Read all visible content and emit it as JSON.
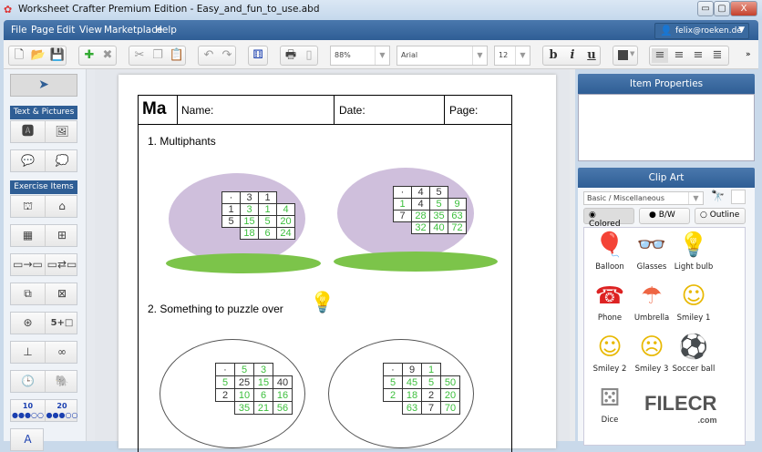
{
  "window": {
    "title": "Worksheet Crafter Premium Edition - Easy_and_fun_to_use.abd",
    "minimize": "▭",
    "maximize": "▢",
    "close": "X"
  },
  "menu": [
    "File",
    "Page",
    "Edit",
    "View",
    "Marketplace",
    "Help"
  ],
  "user": {
    "email": "felix@roeken.de"
  },
  "toolbar": {
    "zoom": "88%",
    "font": "Arial",
    "size": "12",
    "bold": "b",
    "italic": "i",
    "underline": "u",
    "more": "»"
  },
  "sidebar": {
    "text_pictures": "Text & Pictures",
    "exercise_items": "Exercise Items",
    "n10": "10",
    "n20": "20",
    "eq": "5+□"
  },
  "worksheet": {
    "header": {
      "logo": "Ma",
      "name": "Name:",
      "date": "Date:",
      "page": "Page:"
    },
    "section1": "1. Multiphants",
    "section2": "2. Something to puzzle over",
    "grids": [
      [
        [
          [
            "·",
            "k"
          ],
          [
            "3",
            "k"
          ],
          [
            "1",
            "k"
          ]
        ],
        [
          [
            "1",
            "k"
          ],
          [
            "3",
            "g"
          ],
          [
            "1",
            "g"
          ],
          [
            "4",
            "g"
          ]
        ],
        [
          [
            "5",
            "k"
          ],
          [
            "15",
            "g"
          ],
          [
            "5",
            "g"
          ],
          [
            "20",
            "g"
          ]
        ],
        [
          null,
          [
            "18",
            "g"
          ],
          [
            "6",
            "g"
          ],
          [
            "24",
            "g"
          ]
        ]
      ],
      [
        [
          [
            "·",
            "k"
          ],
          [
            "4",
            "k"
          ],
          [
            "5",
            "k"
          ]
        ],
        [
          [
            "1",
            "g"
          ],
          [
            "4",
            "k"
          ],
          [
            "5",
            "g"
          ],
          [
            "9",
            "g"
          ]
        ],
        [
          [
            "7",
            "k"
          ],
          [
            "28",
            "g"
          ],
          [
            "35",
            "g"
          ],
          [
            "63",
            "g"
          ]
        ],
        [
          null,
          [
            "32",
            "g"
          ],
          [
            "40",
            "g"
          ],
          [
            "72",
            "g"
          ]
        ]
      ],
      [
        [
          [
            "·",
            "k"
          ],
          [
            "5",
            "g"
          ],
          [
            "3",
            "g"
          ]
        ],
        [
          [
            "5",
            "g"
          ],
          [
            "25",
            "k"
          ],
          [
            "15",
            "g"
          ],
          [
            "40",
            "k"
          ]
        ],
        [
          [
            "2",
            "k"
          ],
          [
            "10",
            "g"
          ],
          [
            "6",
            "g"
          ],
          [
            "16",
            "g"
          ]
        ],
        [
          null,
          [
            "35",
            "g"
          ],
          [
            "21",
            "g"
          ],
          [
            "56",
            "g"
          ]
        ]
      ],
      [
        [
          [
            "·",
            "k"
          ],
          [
            "9",
            "k"
          ],
          [
            "1",
            "g"
          ]
        ],
        [
          [
            "5",
            "g"
          ],
          [
            "45",
            "g"
          ],
          [
            "5",
            "g"
          ],
          [
            "50",
            "g"
          ]
        ],
        [
          [
            "2",
            "g"
          ],
          [
            "18",
            "g"
          ],
          [
            "2",
            "k"
          ],
          [
            "20",
            "g"
          ]
        ],
        [
          null,
          [
            "63",
            "g"
          ],
          [
            "7",
            "k"
          ],
          [
            "70",
            "g"
          ]
        ]
      ]
    ]
  },
  "colors": {
    "green": "#3cbf3c",
    "black": "#333333",
    "accent": "#2f5e95"
  },
  "item_properties": {
    "title": "Item Properties"
  },
  "clipart": {
    "title": "Clip Art",
    "category": "Basic / Miscellaneous",
    "colored": "Colored",
    "bw": "B/W",
    "outline": "Outline",
    "items": [
      {
        "label": "Balloon",
        "icon": "🎈"
      },
      {
        "label": "Glasses",
        "icon": "👓"
      },
      {
        "label": "Light bulb",
        "icon": "💡"
      },
      {
        "label": "Phone",
        "icon": "☎"
      },
      {
        "label": "Umbrella",
        "icon": "☂"
      },
      {
        "label": "Smiley 1",
        "icon": "☺"
      },
      {
        "label": "Smiley 2",
        "icon": "☺"
      },
      {
        "label": "Smiley 3",
        "icon": "☹"
      },
      {
        "label": "Soccer ball",
        "icon": "⚽"
      },
      {
        "label": "Dice",
        "icon": "⚄"
      }
    ]
  },
  "watermark": {
    "text": "FILECR",
    "sub": ".com"
  }
}
